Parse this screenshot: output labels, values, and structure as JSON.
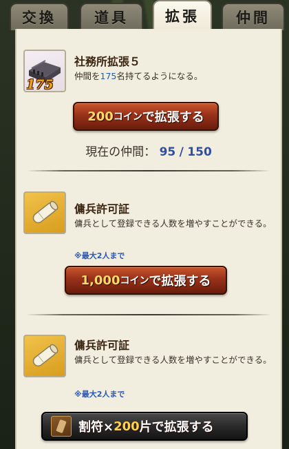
{
  "tabs": [
    {
      "label": "交換",
      "active": false
    },
    {
      "label": "道具",
      "active": false
    },
    {
      "label": "拡張",
      "active": true
    },
    {
      "label": "仲間",
      "active": false
    }
  ],
  "office_upgrade": {
    "icon": "office-building-icon",
    "level": "175",
    "title": "社務所拡張５",
    "desc_prefix": "仲間を",
    "desc_count": "175",
    "desc_suffix": "名持てるようになる。",
    "button_amount": "200",
    "button_unit": "コイン",
    "button_label": "で拡張する",
    "members_label": "現在の仲間：",
    "members_current": "95",
    "members_sep": "/",
    "members_max": "150"
  },
  "permit_coin": {
    "icon": "scroll-icon",
    "title": "傭兵許可証",
    "desc": "傭兵として登録できる人数を増やすことができる。",
    "note": "※最大2人まで",
    "button_amount": "1,000",
    "button_unit": "コイン",
    "button_label": "で拡張する"
  },
  "permit_tally": {
    "icon": "scroll-icon",
    "title": "傭兵許可証",
    "desc": "傭兵として登録できる人数を増やすことができる。",
    "note": "※最大2人まで",
    "button_icon": "tally-icon",
    "button_prefix": "割符×",
    "button_amount": "200",
    "button_label": "片で拡張する"
  },
  "colors": {
    "panel_bg": "#f2eedf",
    "button_red": "#98311a",
    "accent_blue": "#2f4fa0",
    "coin_gold": "#ffd96a"
  }
}
